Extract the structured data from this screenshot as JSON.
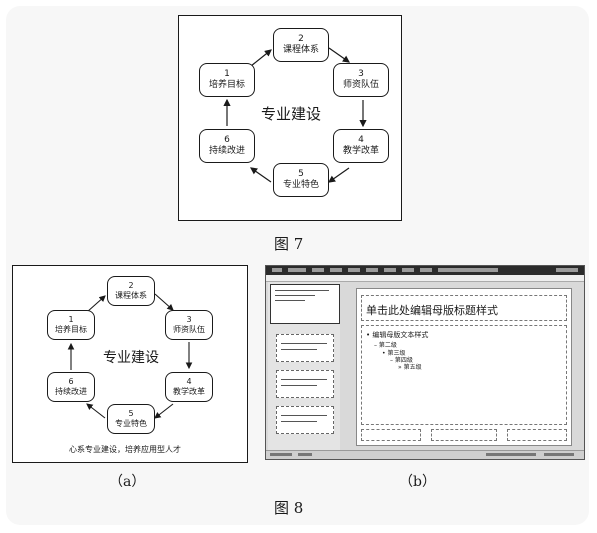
{
  "cycle": {
    "center": "专业建设",
    "nodes": [
      {
        "num": "1",
        "label": "培养目标"
      },
      {
        "num": "2",
        "label": "课程体系"
      },
      {
        "num": "3",
        "label": "师资队伍"
      },
      {
        "num": "4",
        "label": "教学改革"
      },
      {
        "num": "5",
        "label": "专业特色"
      },
      {
        "num": "6",
        "label": "持续改进"
      }
    ]
  },
  "figure7": {
    "caption": "图 7"
  },
  "figure8": {
    "caption": "图 8",
    "a": {
      "label": "（a）",
      "subtitle": "心系专业建设，培养应用型人才"
    },
    "b": {
      "label": "（b）",
      "master_title": "单击此处编辑母版标题样式",
      "levels": [
        "• 编辑母版文本样式",
        "– 第二级",
        "• 第三级",
        "– 第四级",
        "» 第五级"
      ]
    }
  }
}
